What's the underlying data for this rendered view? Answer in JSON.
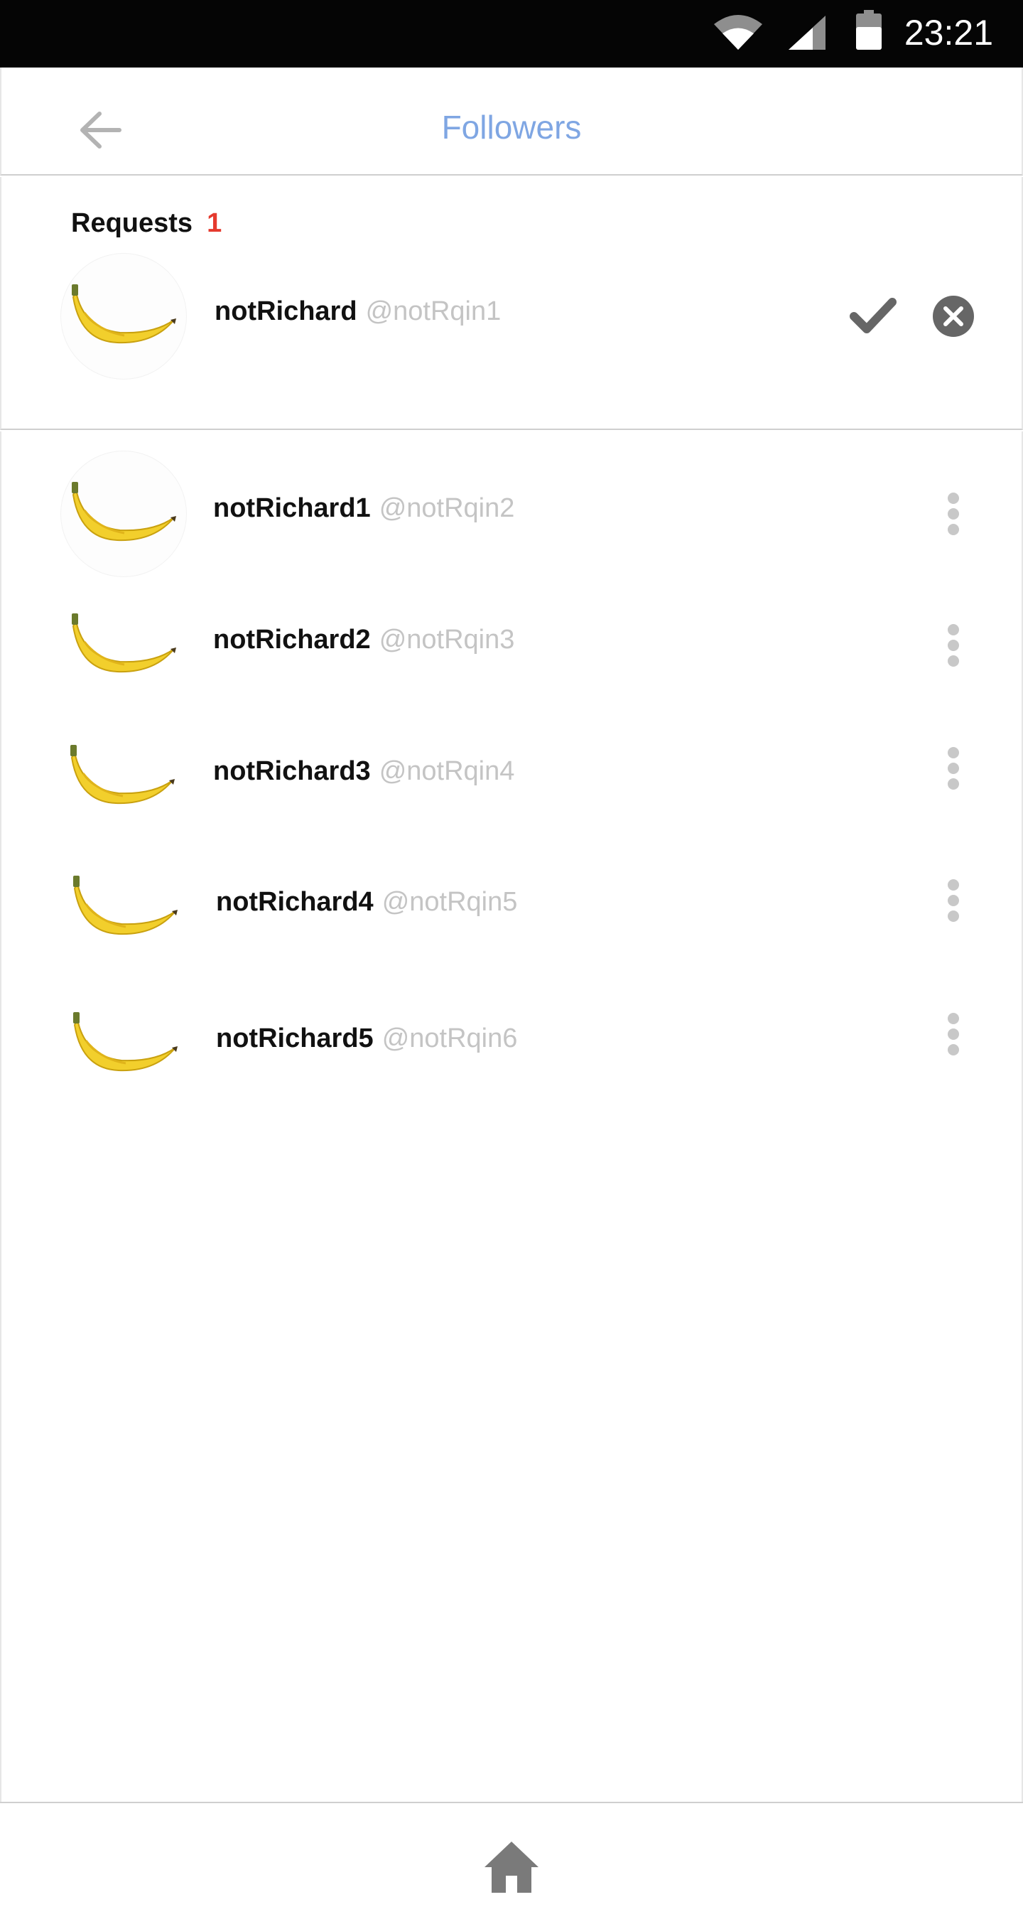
{
  "status_bar": {
    "time": "23:21",
    "icons": [
      "wifi-icon",
      "signal-icon",
      "battery-icon"
    ]
  },
  "header": {
    "title": "Followers",
    "back_icon": "arrow-left-icon",
    "title_color": "#7fa6e3"
  },
  "requests": {
    "label": "Requests",
    "count": "1",
    "count_color": "#e53a2e",
    "items": [
      {
        "name": "notRichard",
        "handle": "@notRqin1",
        "avatar": "banana-avatar",
        "accept_icon": "check-icon",
        "reject_icon": "close-circle-icon"
      }
    ]
  },
  "followers": {
    "items": [
      {
        "name": "notRichard1",
        "handle": "@notRqin2",
        "avatar": "banana-avatar",
        "menu_icon": "more-vertical-icon"
      },
      {
        "name": "notRichard2",
        "handle": "@notRqin3",
        "avatar": "banana-avatar",
        "menu_icon": "more-vertical-icon"
      },
      {
        "name": "notRichard3",
        "handle": "@notRqin4",
        "avatar": "banana-avatar",
        "menu_icon": "more-vertical-icon"
      },
      {
        "name": "notRichard4",
        "handle": "@notRqin5",
        "avatar": "banana-avatar",
        "menu_icon": "more-vertical-icon"
      },
      {
        "name": "notRichard5",
        "handle": "@notRqin6",
        "avatar": "banana-avatar",
        "menu_icon": "more-vertical-icon"
      }
    ]
  },
  "bottom_nav": {
    "home_icon": "home-icon"
  }
}
